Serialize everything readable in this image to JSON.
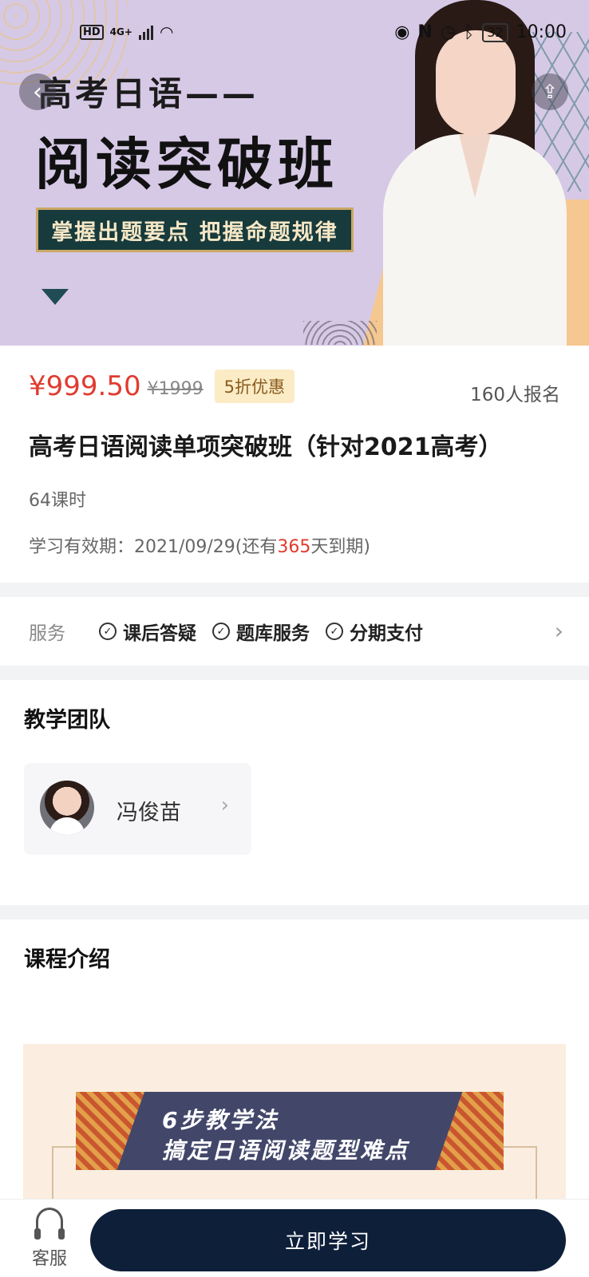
{
  "status_bar": {
    "network_badge": "HD",
    "network_type": "4G+",
    "battery": "32",
    "time": "10:00"
  },
  "hero": {
    "title_line1": "高考日语——",
    "title_line2": "阅读突破班",
    "tagline": "掌握出题要点  把握命题规律",
    "back_icon": "chevron-left-icon",
    "share_icon": "share-icon",
    "colors": {
      "background": "#d6c9e6",
      "tagline_bg": "#173a3c",
      "accent": "#f5c791"
    }
  },
  "course": {
    "price": "¥999.50",
    "original_price": "¥1999",
    "discount": "5折优惠",
    "enrolled": "160人报名",
    "title": "高考日语阅读单项突破班（针对2021高考）",
    "hours": "64课时",
    "validity_prefix": "学习有效期：2021/09/29(还有",
    "validity_days": "365",
    "validity_suffix": "天到期)",
    "price_color": "#e13b2f"
  },
  "services": {
    "label": "服务",
    "items": [
      "课后答疑",
      "题库服务",
      "分期支付"
    ]
  },
  "team": {
    "title": "教学团队",
    "teacher_name": "冯俊苗"
  },
  "intro": {
    "title": "课程介绍",
    "banner_line1": "6步教学法",
    "banner_line2": "搞定日语阅读题型难点"
  },
  "bottom_bar": {
    "customer_service": "客服",
    "cta": "立即学习",
    "cta_color": "#0e1f3a"
  }
}
